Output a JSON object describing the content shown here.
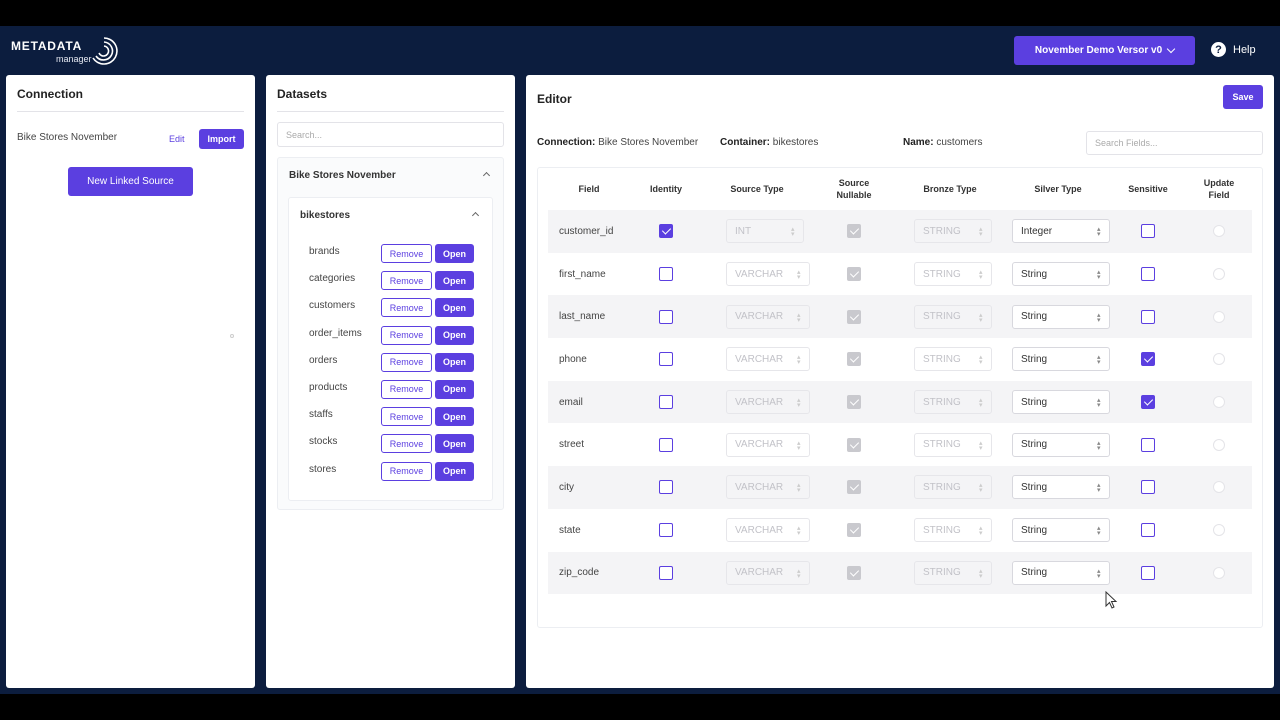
{
  "app": {
    "logo_brand": "METADATA",
    "logo_sub": "manager",
    "version_label": "November Demo Versor v0",
    "help_label": "Help",
    "colors": {
      "accent": "#5b3fe0",
      "header_bg": "#0c1d3e"
    }
  },
  "connection": {
    "title": "Connection",
    "name": "Bike Stores November",
    "edit_label": "Edit",
    "import_label": "Import",
    "new_linked_label": "New Linked Source"
  },
  "datasets": {
    "title": "Datasets",
    "search_placeholder": "Search...",
    "source_name": "Bike Stores November",
    "container_name": "bikestores",
    "remove_label": "Remove",
    "open_label": "Open",
    "tables": [
      "brands",
      "categories",
      "customers",
      "order_items",
      "orders",
      "products",
      "staffs",
      "stocks",
      "stores"
    ]
  },
  "editor": {
    "title": "Editor",
    "save_label": "Save",
    "connection_label": "Connection:",
    "connection_value": "Bike Stores November",
    "container_label": "Container:",
    "container_value": "bikestores",
    "name_label": "Name:",
    "name_value": "customers",
    "search_placeholder": "Search Fields...",
    "columns": [
      "Field",
      "Identity",
      "Source Type",
      "Source Nullable",
      "Bronze Type",
      "Silver Type",
      "Sensitive",
      "Update Field"
    ],
    "rows": [
      {
        "field": "customer_id",
        "identity": true,
        "source_type": "INT",
        "source_nullable": true,
        "bronze_type": "STRING",
        "silver_type": "Integer",
        "sensitive": false,
        "update_field": false
      },
      {
        "field": "first_name",
        "identity": false,
        "source_type": "VARCHAR",
        "source_nullable": true,
        "bronze_type": "STRING",
        "silver_type": "String",
        "sensitive": false,
        "update_field": false
      },
      {
        "field": "last_name",
        "identity": false,
        "source_type": "VARCHAR",
        "source_nullable": true,
        "bronze_type": "STRING",
        "silver_type": "String",
        "sensitive": false,
        "update_field": false
      },
      {
        "field": "phone",
        "identity": false,
        "source_type": "VARCHAR",
        "source_nullable": true,
        "bronze_type": "STRING",
        "silver_type": "String",
        "sensitive": true,
        "update_field": false
      },
      {
        "field": "email",
        "identity": false,
        "source_type": "VARCHAR",
        "source_nullable": true,
        "bronze_type": "STRING",
        "silver_type": "String",
        "sensitive": true,
        "update_field": false
      },
      {
        "field": "street",
        "identity": false,
        "source_type": "VARCHAR",
        "source_nullable": true,
        "bronze_type": "STRING",
        "silver_type": "String",
        "sensitive": false,
        "update_field": false
      },
      {
        "field": "city",
        "identity": false,
        "source_type": "VARCHAR",
        "source_nullable": true,
        "bronze_type": "STRING",
        "silver_type": "String",
        "sensitive": false,
        "update_field": false
      },
      {
        "field": "state",
        "identity": false,
        "source_type": "VARCHAR",
        "source_nullable": true,
        "bronze_type": "STRING",
        "silver_type": "String",
        "sensitive": false,
        "update_field": false
      },
      {
        "field": "zip_code",
        "identity": false,
        "source_type": "VARCHAR",
        "source_nullable": true,
        "bronze_type": "STRING",
        "silver_type": "String",
        "sensitive": false,
        "update_field": false
      }
    ]
  }
}
